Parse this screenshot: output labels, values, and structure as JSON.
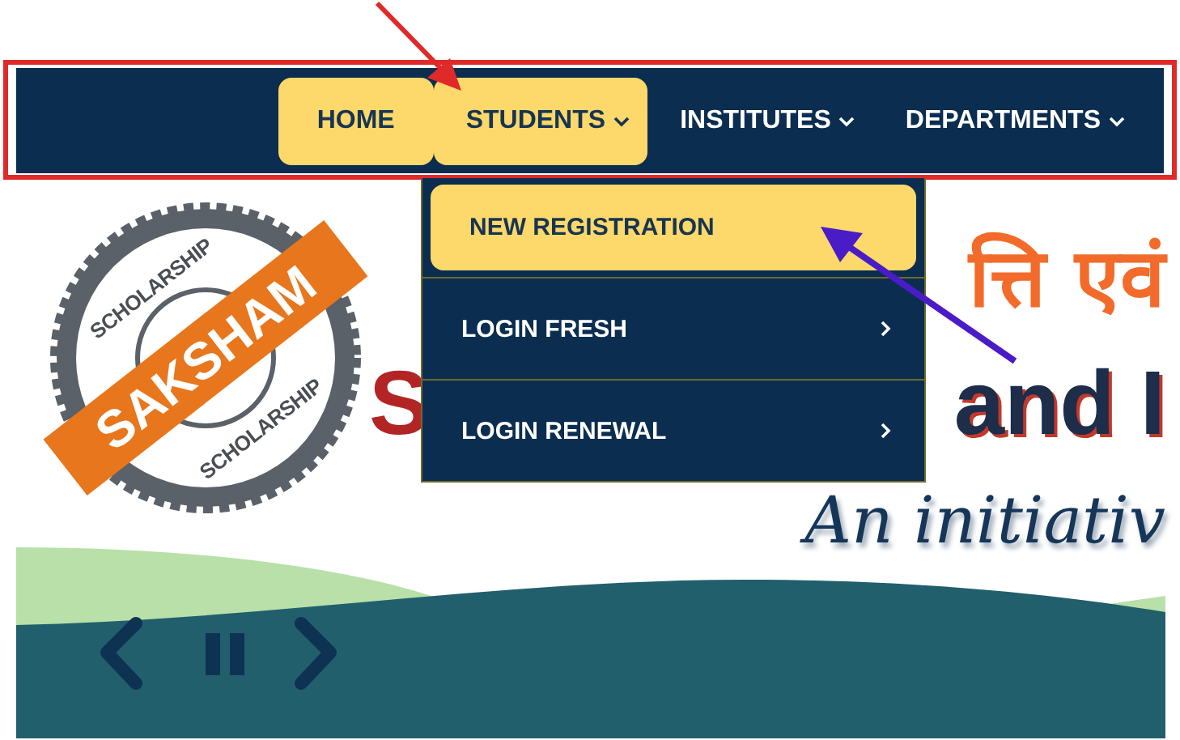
{
  "nav": {
    "items": [
      {
        "label": "HOME",
        "highlighted": true,
        "has_caret": false
      },
      {
        "label": "STUDENTS",
        "highlighted": true,
        "has_caret": true
      },
      {
        "label": "INSTITUTES",
        "highlighted": false,
        "has_caret": true
      },
      {
        "label": "DEPARTMENTS",
        "highlighted": false,
        "has_caret": true
      }
    ]
  },
  "dropdown": {
    "items": [
      {
        "label": "NEW REGISTRATION",
        "highlighted": true,
        "has_submenu": false
      },
      {
        "label": "LOGIN FRESH",
        "highlighted": false,
        "has_submenu": true
      },
      {
        "label": "LOGIN RENEWAL",
        "highlighted": false,
        "has_submenu": true
      }
    ]
  },
  "logo": {
    "ring_top": "SCHOLARSHIP",
    "ribbon": "SAKSHAM",
    "ring_bottom": "SCHOLARSHIP"
  },
  "hero": {
    "hindi_title": "त्ति एवं",
    "title_start": "S",
    "title_end": "and I",
    "tagline": "An initiativ"
  }
}
